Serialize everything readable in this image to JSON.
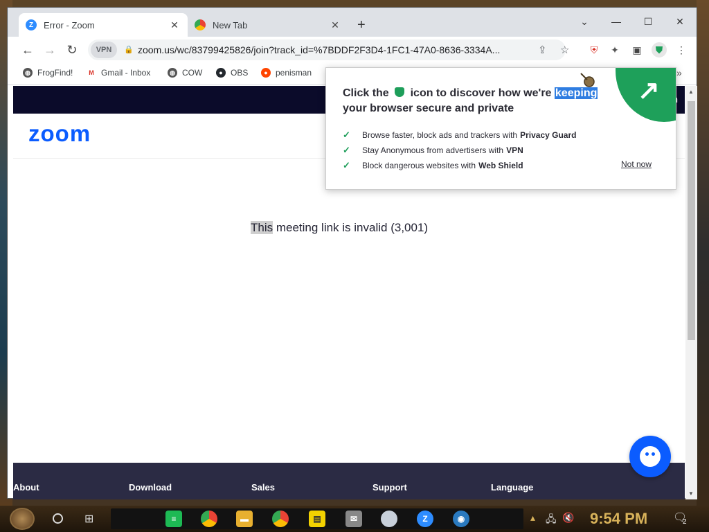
{
  "browser": {
    "tabs": [
      {
        "title": "Error - Zoom",
        "active": true,
        "favicon": "zoom-icon",
        "favicon_color": "#2d8cff"
      },
      {
        "title": "New Tab",
        "active": false,
        "favicon": "chrome-icon"
      }
    ],
    "url": "zoom.us/wc/83799425826/join?track_id=%7BDDF2F3D4-1FC1-47A0-8636-3334A...",
    "vpn_label": "VPN",
    "bookmarks": [
      {
        "label": "FrogFind!",
        "icon": "globe-icon",
        "color": "#555555"
      },
      {
        "label": "Gmail - Inbox",
        "icon": "gmail-icon",
        "color": "#d93025"
      },
      {
        "label": "COW",
        "icon": "globe-icon",
        "color": "#555555"
      },
      {
        "label": "OBS",
        "icon": "github-icon",
        "color": "#24292e"
      },
      {
        "label": "penisman",
        "icon": "reddit-icon",
        "color": "#ff4500"
      }
    ]
  },
  "popup": {
    "title_part1": "Click the",
    "title_part2": "icon to discover how we're",
    "title_selected": "keeping",
    "title_part3": "your browser secure and private",
    "features": [
      {
        "text": "Browse faster, block ads and trackers with",
        "bold": "Privacy Guard"
      },
      {
        "text": "Stay Anonymous from advertisers with",
        "bold": "VPN"
      },
      {
        "text": "Block dangerous websites with",
        "bold": "Web Shield"
      }
    ],
    "dismiss_label": "Not now",
    "accent_color": "#1ea05a"
  },
  "page": {
    "signin_label": "In",
    "logo": "zoom",
    "message_highlight": "This",
    "message_rest": " meeting link is invalid (3,001)",
    "footer_links": [
      "About",
      "Download",
      "Sales",
      "Support",
      "Language"
    ],
    "brand_color": "#0b5cff"
  },
  "taskbar": {
    "clock": "9:54 PM",
    "notification_count": "2"
  }
}
